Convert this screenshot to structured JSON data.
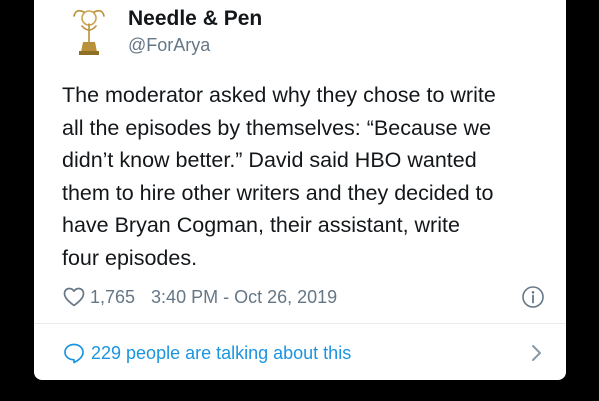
{
  "tweet": {
    "display_name": "Needle & Pen",
    "handle": "@ForArya",
    "text": "The moderator asked why they chose to write\nall the episodes by themselves: “Because we\ndidn’t know better.” David said HBO wanted\nthem to hire other writers and they decided to\nhave Bryan Cogman, their assistant, write\nfour episodes.",
    "like_count": "1,765",
    "timestamp": "3:40 PM - Oct 26, 2019",
    "conversation_label": "229 people are talking about this"
  },
  "icons": {
    "avatar": "emmy-statuette-icon",
    "like": "heart-icon",
    "info": "info-icon",
    "conversation": "speech-bubble-icon",
    "chevron": "chevron-right-icon"
  },
  "colors": {
    "background": "#000000",
    "card": "#ffffff",
    "text_primary": "#14171a",
    "text_secondary": "#657786",
    "link_blue": "#1b95e0"
  }
}
